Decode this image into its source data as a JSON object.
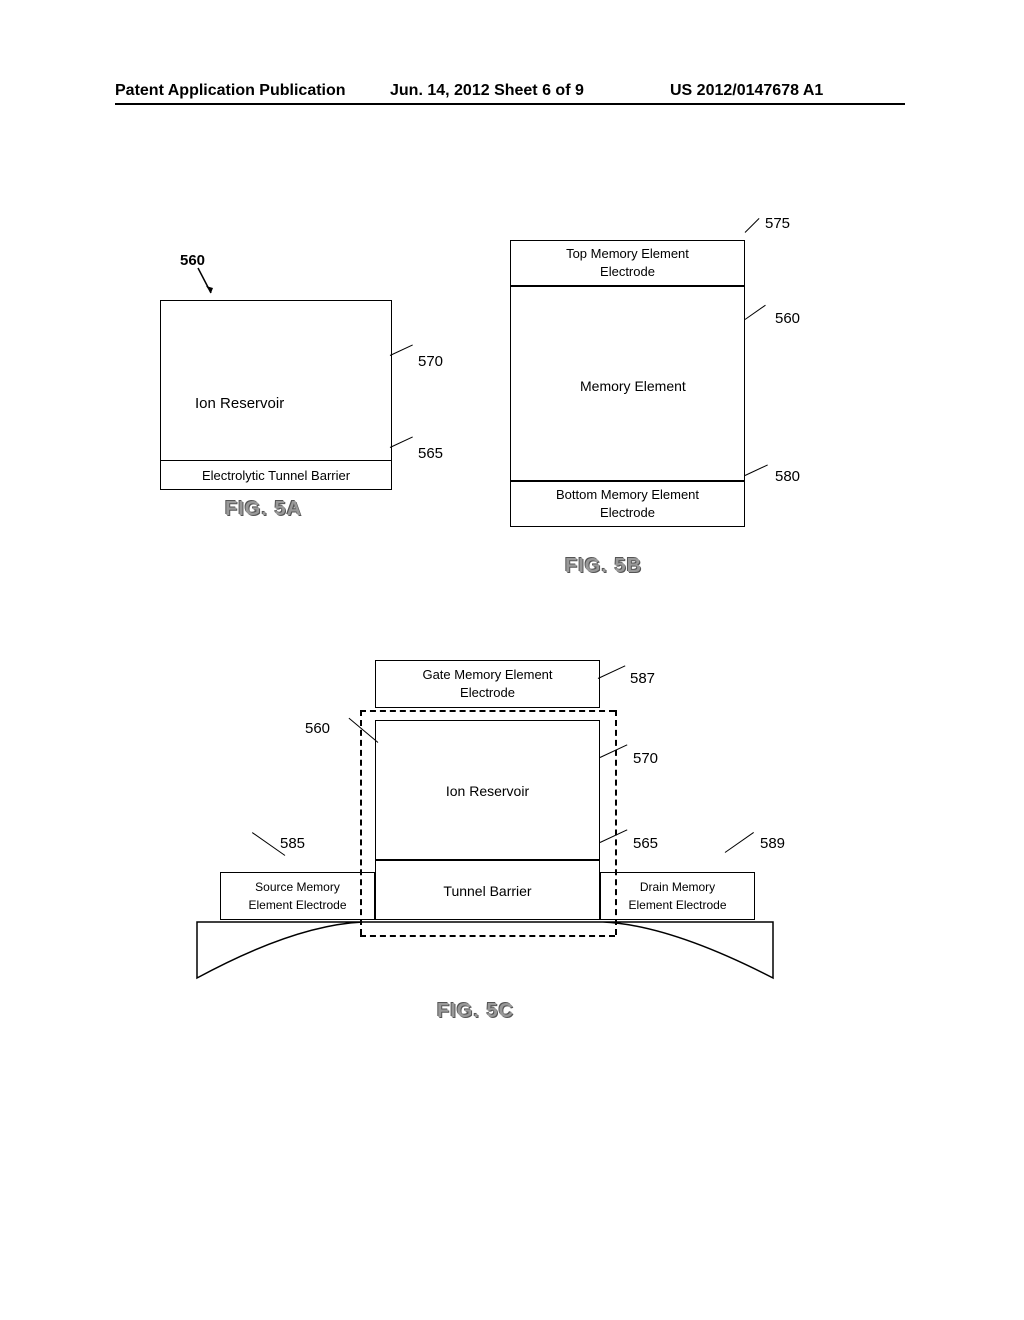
{
  "header": {
    "left": "Patent Application Publication",
    "mid": "Jun. 14, 2012  Sheet 6 of 9",
    "right": "US 2012/0147678 A1"
  },
  "fig5a": {
    "ref560": "560",
    "ref570": "570",
    "ref565": "565",
    "ion": "Ion Reservoir",
    "tunnel": "Electrolytic Tunnel Barrier",
    "caption": "FIG. 5A"
  },
  "fig5b": {
    "ref575": "575",
    "ref560": "560",
    "ref580": "580",
    "top_line1": "Top Memory Element",
    "top_line2": "Electrode",
    "mem": "Memory Element",
    "bottom_line1": "Bottom Memory Element",
    "bottom_line2": "Electrode",
    "caption": "FIG. 5B"
  },
  "fig5c": {
    "ref587": "587",
    "ref560": "560",
    "ref570": "570",
    "ref565": "565",
    "ref585": "585",
    "ref589": "589",
    "gate_line1": "Gate Memory Element",
    "gate_line2": "Electrode",
    "ion": "Ion Reservoir",
    "tunnel": "Tunnel Barrier",
    "source_line1": "Source Memory",
    "source_line2": "Element Electrode",
    "drain_line1": "Drain Memory",
    "drain_line2": "Element Electrode",
    "caption": "FIG. 5C"
  }
}
